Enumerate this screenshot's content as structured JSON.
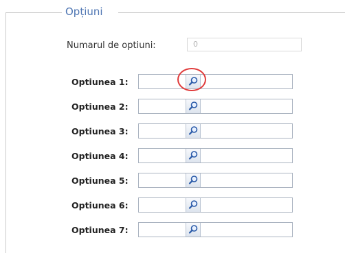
{
  "section": {
    "legend": "Opțiuni"
  },
  "count": {
    "label": "Numarul de optiuni:",
    "value": "0"
  },
  "options": [
    {
      "label": "Optiunea 1:",
      "value": ""
    },
    {
      "label": "Optiunea 2:",
      "value": ""
    },
    {
      "label": "Optiunea 3:",
      "value": ""
    },
    {
      "label": "Optiunea 4:",
      "value": ""
    },
    {
      "label": "Optiunea 5:",
      "value": ""
    },
    {
      "label": "Optiunea 6:",
      "value": ""
    },
    {
      "label": "Optiunea 7:",
      "value": ""
    }
  ],
  "icons": {
    "lookup": "search-icon"
  },
  "colors": {
    "legend": "#4f76b3",
    "highlight": "#e03a3a"
  }
}
